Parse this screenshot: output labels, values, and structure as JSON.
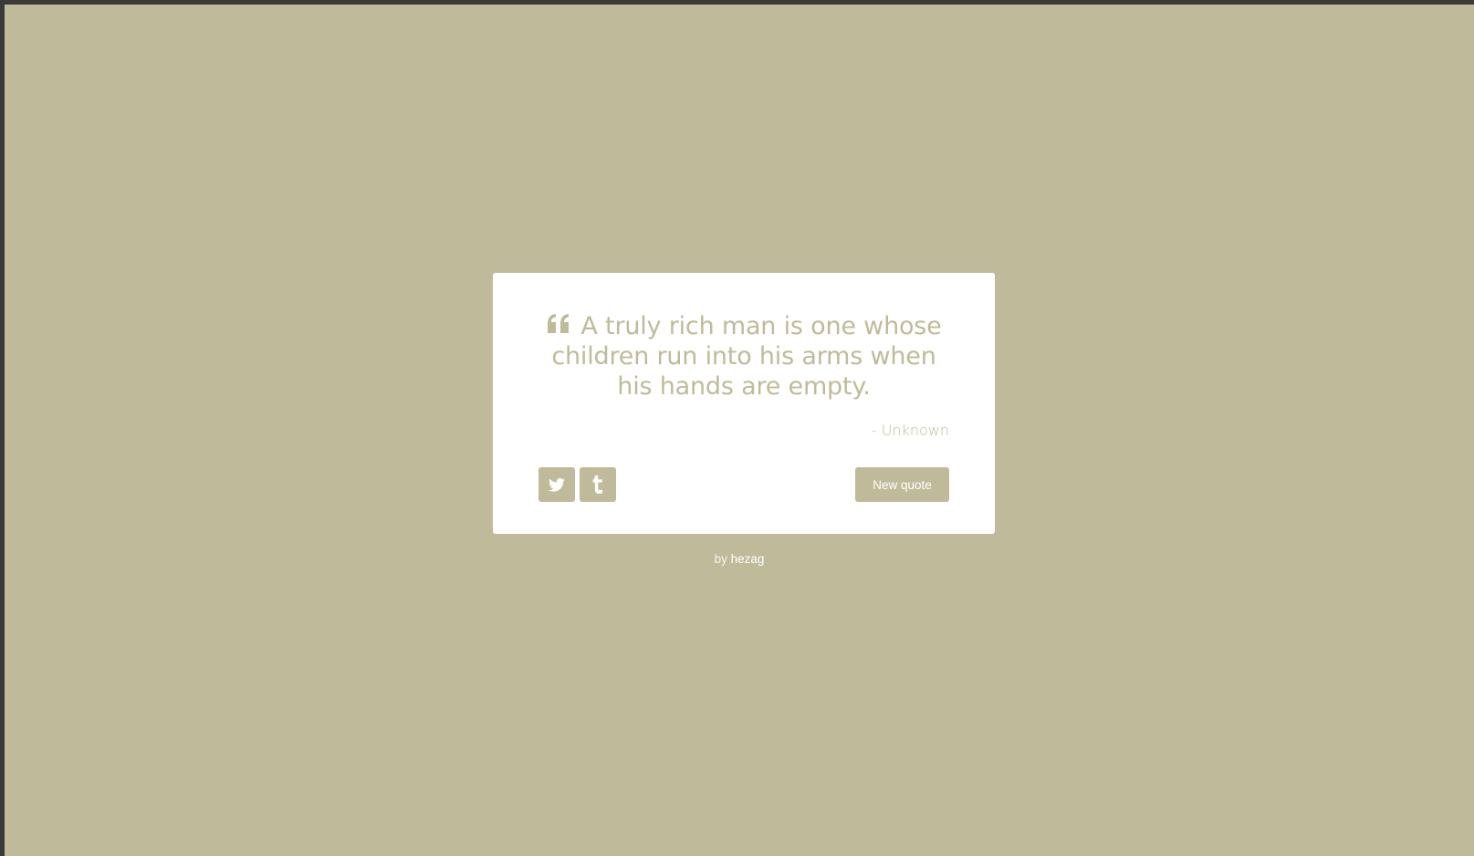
{
  "theme": {
    "background": "#bfbb9a",
    "accent": "#bfbb9a",
    "card": "#ffffff"
  },
  "quote": {
    "icon": "quote-left-icon",
    "text": "A truly rich man is one whose children run into his arms when his hands are empty.",
    "author": "- Unknown"
  },
  "actions": {
    "twitter_icon": "twitter-icon",
    "tumblr_icon": "tumblr-icon",
    "new_quote_label": "New quote"
  },
  "footer": {
    "by_text": "by",
    "author_link": "hezag"
  }
}
